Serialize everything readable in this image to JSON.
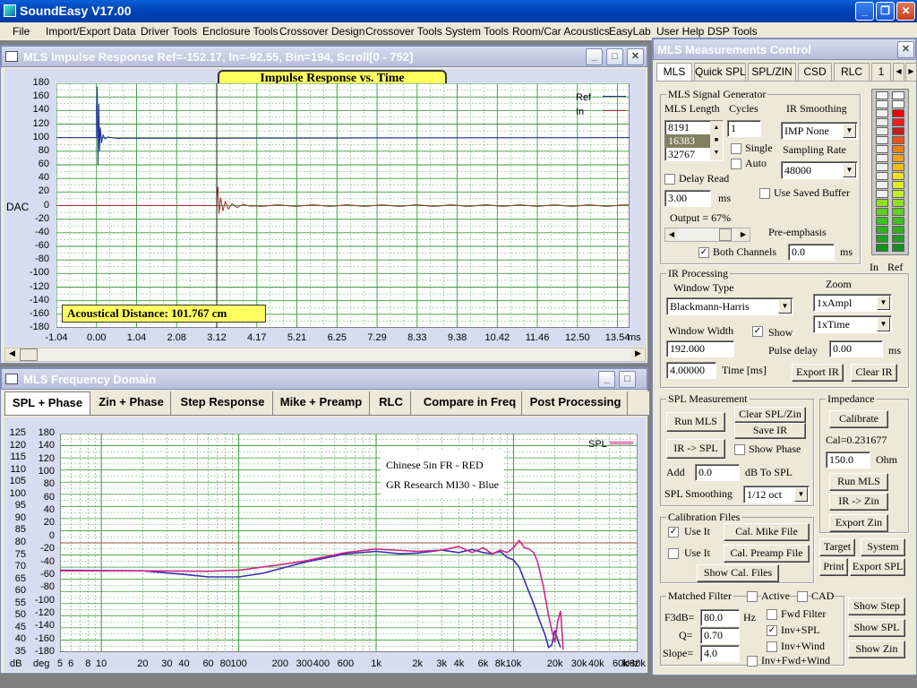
{
  "app": {
    "title": "SoundEasy V17.00",
    "icon": "app-icon"
  },
  "menu": [
    "File",
    "Import/Export Data",
    "Driver Tools",
    "Enclosure Tools",
    "Crossover Design",
    "Crossover Tools",
    "System Tools",
    "Room/Car Acoustics",
    "EasyLab",
    "User Help",
    "DSP Tools"
  ],
  "impulse": {
    "window_title": "MLS Impulse Response  Ref=-152.17, In=-92.55, Bin=194, Scroll[0 - 752]",
    "chart_title": "Impulse Response vs. Time",
    "ylabel": "DAC",
    "yticks": [
      "180",
      "160",
      "140",
      "120",
      "100",
      "80",
      "60",
      "40",
      "20",
      "0",
      "-20",
      "-40",
      "-60",
      "-80",
      "-100",
      "-120",
      "-140",
      "-160",
      "-180"
    ],
    "xticks": [
      "-1.04",
      "0.00",
      "1.04",
      "2.08",
      "3.12",
      "4.17",
      "5.21",
      "6.25",
      "7.29",
      "8.33",
      "9.38",
      "10.42",
      "11.46",
      "12.50",
      "13.54"
    ],
    "xunit": "ms",
    "legend": [
      {
        "name": "Ref",
        "color": "#1f2f9a"
      },
      {
        "name": "In",
        "color": "#a03030"
      }
    ],
    "distance_label": "Acoustical Distance: 101.767 cm"
  },
  "freq": {
    "window_title": "MLS Frequency Domain",
    "tabs": [
      "SPL + Phase",
      "Zin + Phase",
      "Step Response",
      "Mike + Preamp",
      "RLC",
      "Compare in Freq",
      "Post Processing"
    ],
    "yticks_db": [
      "125",
      "120",
      "115",
      "110",
      "105",
      "100",
      "95",
      "90",
      "85",
      "80",
      "75",
      "70",
      "65",
      "60",
      "55",
      "50",
      "45",
      "40",
      "35"
    ],
    "yticks_deg": [
      "180",
      "140",
      "120",
      "100",
      "80",
      "60",
      "40",
      "20",
      "0",
      "-20",
      "-40",
      "-60",
      "-80",
      "-100",
      "-120",
      "-140",
      "-160",
      "-180"
    ],
    "yunit_db": "dB",
    "yunit_deg": "deg",
    "xticks": [
      "5",
      "6",
      "8",
      "10",
      "20",
      "30",
      "40",
      "60",
      "80",
      "100",
      "200",
      "300",
      "400",
      "600",
      "1k",
      "2k",
      "3k",
      "4k",
      "6k",
      "8k",
      "10k",
      "20k",
      "30k",
      "40k",
      "60k",
      "80k"
    ],
    "xunit": "Hz",
    "xunit_tail": "kHz",
    "legend": "SPL",
    "notes": [
      "Chinese 5in FR - RED",
      "GR Research MI30 - Blue"
    ]
  },
  "control": {
    "window_title": "MLS Measurements Control",
    "tabs": [
      "MLS",
      "Quick SPL",
      "SPL/ZIN",
      "CSD",
      "RLC",
      "1"
    ],
    "sig_gen": {
      "group": "MLS Signal Generator",
      "mls_length_label": "MLS Length",
      "mls_lengths": [
        "8191",
        "16383",
        "32767"
      ],
      "cycles_label": "Cycles",
      "cycles": "1",
      "single": "Single",
      "auto": "Auto",
      "ir_smoothing_label": "IR Smoothing",
      "ir_smoothing": "IMP None",
      "sampling_rate_label": "Sampling Rate",
      "sampling_rate": "48000",
      "delay_read": "Delay Read",
      "delay_value": "3.00",
      "delay_unit": "ms",
      "use_saved_buffer": "Use Saved Buffer",
      "output": "Output = 67%",
      "pre_emphasis": "Pre-emphasis",
      "both_channels": "Both Channels",
      "pre_value": "0.0",
      "pre_unit": "ms"
    },
    "meter": {
      "in_label": "In",
      "ref_label": "Ref"
    },
    "ir_proc": {
      "group": "IR Processing",
      "window_type_label": "Window Type",
      "window_type": "Blackmann-Harris",
      "zoom_label": "Zoom",
      "zoom_amp": "1xAmpl",
      "zoom_time": "1xTime",
      "window_width_label": "Window Width",
      "show": "Show",
      "window_width": "192.000",
      "pulse_delay_label": "Pulse delay",
      "pulse_delay": "0.00",
      "pulse_unit": "ms",
      "time_value": "4.00000",
      "time_label": "Time [ms]",
      "export_ir": "Export IR",
      "clear_ir": "Clear IR"
    },
    "spl": {
      "group": "SPL Measurement",
      "run_mls": "Run MLS",
      "clear_spl": "Clear SPL/Zin",
      "save_ir": "Save IR",
      "ir_spl": "IR -> SPL",
      "show_phase": "Show Phase",
      "add_label": "Add",
      "add_value": "0.0",
      "add_unit": "dB  To SPL",
      "smoothing_label": "SPL Smoothing",
      "smoothing": "1/12 oct"
    },
    "calib": {
      "group": "Calibration Files",
      "use_it": "Use It",
      "cal_mike": "Cal. Mike File",
      "cal_preamp": "Cal. Preamp File",
      "show_cal": "Show Cal. Files"
    },
    "imp": {
      "group": "Impedance",
      "calibrate": "Calibrate",
      "cal_value": "Cal=0.231677",
      "ohm_value": "150.0",
      "ohm_unit": "Ohm",
      "run_mls": "Run MLS",
      "ir_zin": "IR -> Zin",
      "export_zin": "Export Zin"
    },
    "buttons": {
      "target": "Target",
      "system": "System",
      "print": "Print",
      "export_spl": "Export SPL"
    },
    "matched": {
      "group": "Matched Filter",
      "active": "Active",
      "cad": "CAD",
      "f3db_label": "F3dB=",
      "f3db": "80.0",
      "f3db_unit": "Hz",
      "q_label": "Q=",
      "q": "0.70",
      "slope_label": "Slope=",
      "slope": "4.0",
      "fwd_filter": "Fwd Filter",
      "inv_spl": "Inv+SPL",
      "inv_wind": "Inv+Wind",
      "inv_fwd_wind": "Inv+Fwd+Wind"
    },
    "show": {
      "step": "Show Step",
      "spl": "Show SPL",
      "zin": "Show Zin"
    }
  },
  "colors": {
    "ref_trace": "#1f2f9a",
    "in_trace": "#a03030",
    "blue_curve": "#3a2eb0",
    "red_curve": "#d0288a",
    "grid": "#3a9a3a",
    "plot_bg": "#ffffff",
    "title_bg": "#ffff60"
  }
}
